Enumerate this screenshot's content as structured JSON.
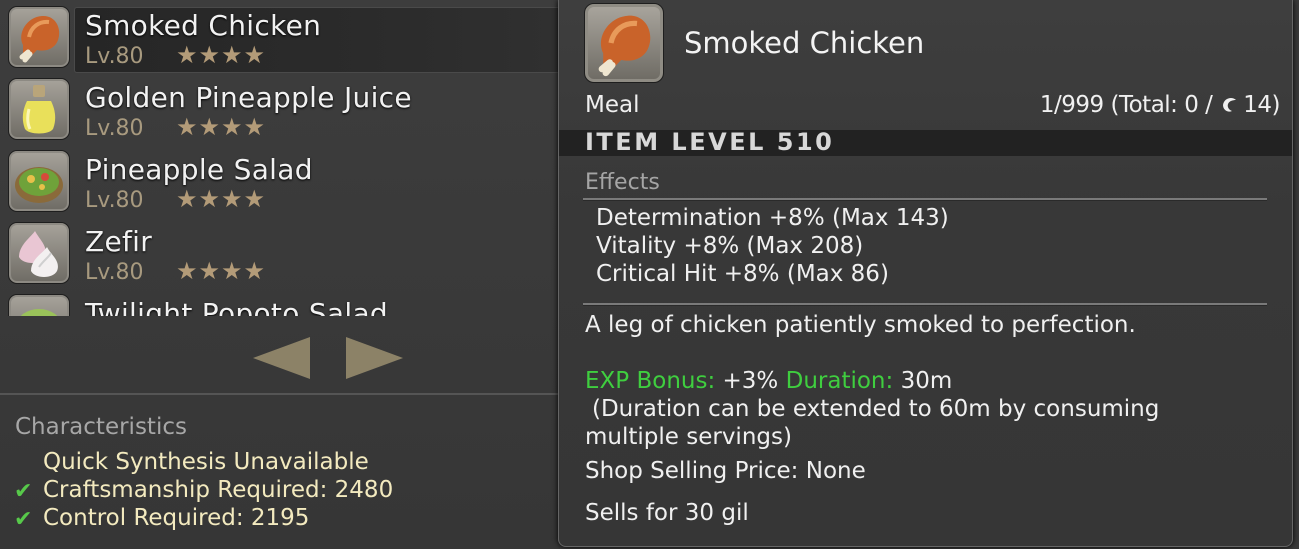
{
  "list": {
    "items": [
      {
        "name": "Smoked Chicken",
        "level": "Lv.80",
        "stars": "★★★★",
        "icon": "smoked-chicken-icon"
      },
      {
        "name": "Golden Pineapple Juice",
        "level": "Lv.80",
        "stars": "★★★★",
        "icon": "pineapple-juice-icon"
      },
      {
        "name": "Pineapple Salad",
        "level": "Lv.80",
        "stars": "★★★★",
        "icon": "pineapple-salad-icon"
      },
      {
        "name": "Zefir",
        "level": "Lv.80",
        "stars": "★★★★",
        "icon": "zefir-icon"
      },
      {
        "name": "Twilight Popoto Salad",
        "icon": "popoto-salad-icon"
      }
    ]
  },
  "characteristics": {
    "title": "Characteristics",
    "lines": [
      {
        "text": "Quick Synthesis Unavailable",
        "check": false
      },
      {
        "text": "Craftsmanship Required: 2480",
        "check": true
      },
      {
        "text": "Control Required: 2195",
        "check": true
      }
    ],
    "check_glyph": "✔"
  },
  "tooltip": {
    "name": "Smoked Chicken",
    "category": "Meal",
    "count_prefix": "1/999 (Total: 0 /",
    "count_suffix": "14)",
    "item_level": "ITEM LEVEL 510",
    "effects_title": "Effects",
    "effects": [
      "Determination +8% (Max 143)",
      "Vitality +8% (Max 208)",
      "Critical Hit +8% (Max 86)"
    ],
    "description": "A leg of chicken patiently smoked to perfection.",
    "exp_label": "EXP Bonus:",
    "exp_value": "+3%",
    "duration_label": "Duration:",
    "duration_value": "30m",
    "duration_note_1": "(Duration can be extended to 60m by consuming",
    "duration_note_2": "multiple servings)",
    "shop_price": "Shop Selling Price: None",
    "sells_for": "Sells for 30 gil"
  },
  "colors": {
    "accent_green": "#3fce3f",
    "characteristic_text": "#f3eabf",
    "stars": "#b39b78"
  }
}
